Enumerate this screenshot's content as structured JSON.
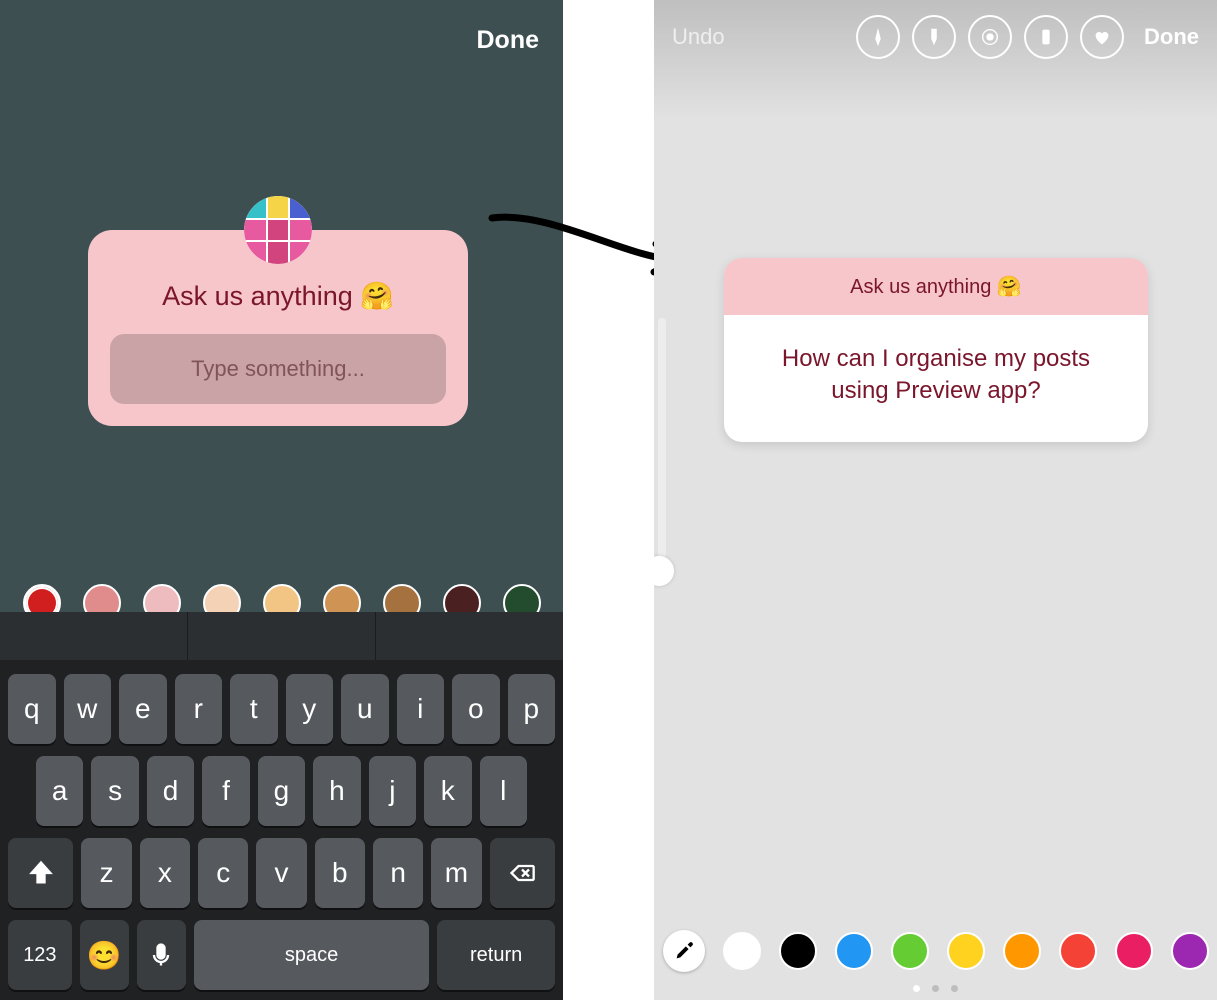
{
  "left": {
    "done_label": "Done",
    "question_prompt": "Ask us anything 🤗",
    "input_placeholder": "Type something...",
    "palette": [
      "#d11f1f",
      "#e08b8c",
      "#eebcbf",
      "#f4d2b6",
      "#f3c584",
      "#cf9353",
      "#a4713f",
      "#4a2020",
      "#234c2e"
    ],
    "pager_active_index": 1,
    "keyboard": {
      "row1": [
        "q",
        "w",
        "e",
        "r",
        "t",
        "y",
        "u",
        "i",
        "o",
        "p"
      ],
      "row2": [
        "a",
        "s",
        "d",
        "f",
        "g",
        "h",
        "j",
        "k",
        "l"
      ],
      "row3_letters": [
        "z",
        "x",
        "c",
        "v",
        "b",
        "n",
        "m"
      ],
      "numbers_label": "123",
      "space_label": "space",
      "return_label": "return"
    }
  },
  "right": {
    "undo_label": "Undo",
    "done_label": "Done",
    "answer_prompt": "Ask us anything 🤗",
    "answer_text": "How can I organise my posts using Preview app?",
    "palette": [
      "#ffffff",
      "#000000",
      "#2196f3",
      "#66cc33",
      "#ffd21f",
      "#ff9800",
      "#f44336",
      "#e91e63",
      "#9c27b0"
    ],
    "pager_active_index": 0
  }
}
